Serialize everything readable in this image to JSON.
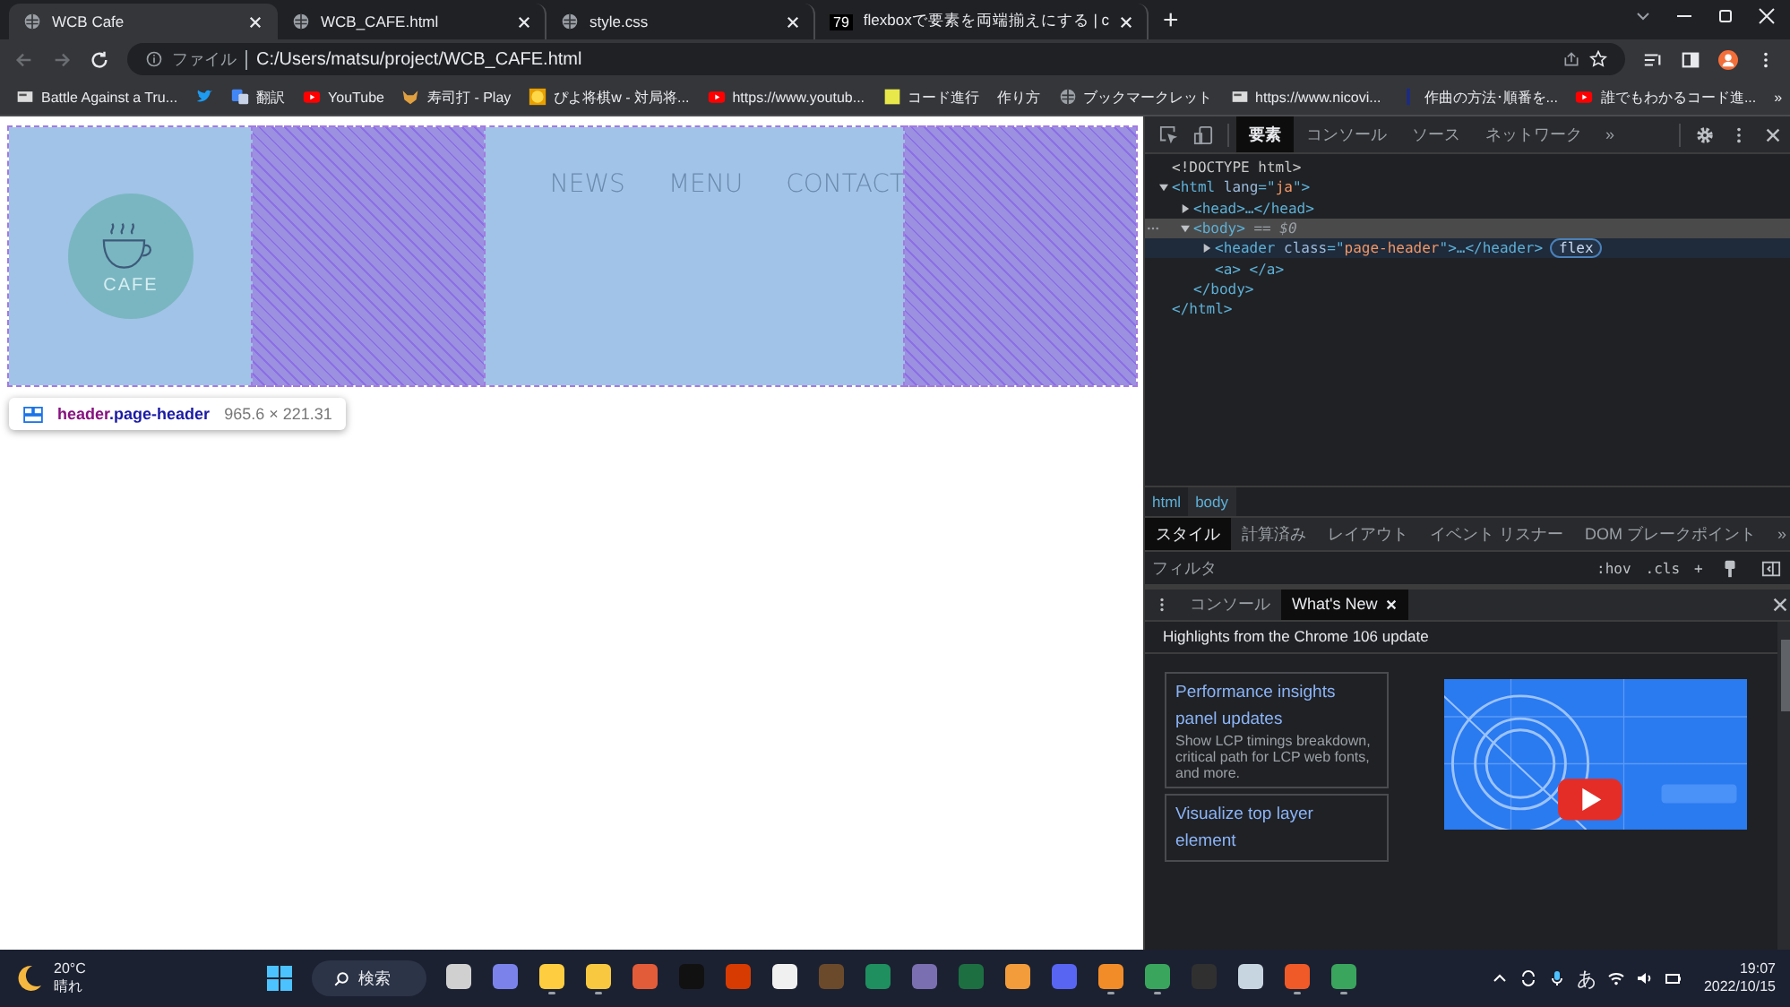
{
  "browser": {
    "tabs": [
      {
        "title": "WCB Cafe",
        "selected": true,
        "kind": "globe"
      },
      {
        "title": "WCB_CAFE.html",
        "selected": false,
        "kind": "globe"
      },
      {
        "title": "style.css",
        "selected": false,
        "kind": "globe"
      },
      {
        "title": "flexboxで要素を両端揃えにする | c",
        "selected": false,
        "kind": "badge",
        "badge": "79"
      }
    ],
    "new_tab": "+",
    "address": {
      "scheme_label": "ファイル",
      "url": "C:/Users/matsu/project/WCB_CAFE.html"
    },
    "bookmarks": [
      {
        "label": "Battle Against a Tru...",
        "kind": "page"
      },
      {
        "kind": "bird"
      },
      {
        "label": "翻訳",
        "kind": "translate"
      },
      {
        "label": "YouTube",
        "kind": "play"
      },
      {
        "label": "寿司打 - Play",
        "kind": "sushi"
      },
      {
        "label": "ぴよ将棋w - 対局将...",
        "kind": "face"
      },
      {
        "label": "https://www.youtub...",
        "kind": "play"
      },
      {
        "label": "コード進行",
        "kind": "folder"
      },
      {
        "label": "作り方",
        "kind": "plain"
      },
      {
        "label": "ブックマークレット",
        "kind": "globe"
      },
      {
        "label": "https://www.nicovi...",
        "kind": "page"
      },
      {
        "label": "作曲の方法･順番を...",
        "kind": "bar"
      },
      {
        "label": "誰でもわかるコード進...",
        "kind": "play"
      }
    ],
    "bookmarks_more": "»"
  },
  "page": {
    "header": {
      "logo_text": "CAFE",
      "nav": [
        "NEWS",
        "MENU",
        "CONTACT"
      ]
    },
    "inspector_tooltip": {
      "tag": "header",
      "class_name": ".page-header",
      "size": "965.6 × 221.31"
    }
  },
  "devtools": {
    "tabs": [
      {
        "label": "要素",
        "selected": true
      },
      {
        "label": "コンソール",
        "selected": false
      },
      {
        "label": "ソース",
        "selected": false
      },
      {
        "label": "ネットワーク",
        "selected": false
      }
    ],
    "tabs_more": "»",
    "dom": [
      {
        "tokens": [
          {
            "text": "<!DOCTYPE html>",
            "kind": "plain"
          }
        ],
        "selected": false,
        "hovered": false
      },
      {
        "tokens": [
          {
            "text": "<html ",
            "kind": "tag"
          },
          {
            "text": "lang",
            "kind": "attr"
          },
          {
            "text": "=\"",
            "kind": "tag"
          },
          {
            "text": "ja",
            "kind": "value"
          },
          {
            "text": "\">",
            "kind": "tag"
          }
        ],
        "selected": false,
        "hovered": false,
        "expanded": true,
        "close": [
          {
            "text": "</html>",
            "kind": "tag"
          }
        ],
        "children": [
          {
            "tokens": [
              {
                "text": "<head>…</head>",
                "kind": "tag"
              }
            ],
            "expanded": false,
            "selected": false,
            "hovered": false
          },
          {
            "tokens": [
              {
                "text": "<body>",
                "kind": "tag"
              },
              {
                "text": " == $0",
                "kind": "note"
              }
            ],
            "expanded": true,
            "selected": true,
            "hovered": false,
            "close": [
              {
                "text": "</body>",
                "kind": "tag"
              }
            ],
            "children": [
              {
                "tokens": [
                  {
                    "text": "<header ",
                    "kind": "tag"
                  },
                  {
                    "text": "class",
                    "kind": "attr"
                  },
                  {
                    "text": "=\"",
                    "kind": "tag"
                  },
                  {
                    "text": "page-header",
                    "kind": "value"
                  },
                  {
                    "text": "\">…</header>",
                    "kind": "tag"
                  }
                ],
                "badge": "flex",
                "expanded": false,
                "selected": false,
                "hovered": true
              },
              {
                "tokens": [
                  {
                    "text": "<a> </a>",
                    "kind": "tag"
                  }
                ],
                "selected": false,
                "hovered": false
              }
            ]
          }
        ]
      }
    ],
    "breadcrumbs": [
      {
        "label": "html",
        "selected": false
      },
      {
        "label": "body",
        "selected": true
      }
    ],
    "styles_tabs": [
      {
        "label": "スタイル",
        "selected": true
      },
      {
        "label": "計算済み",
        "selected": false
      },
      {
        "label": "レイアウト",
        "selected": false
      },
      {
        "label": "イベント リスナー",
        "selected": false
      },
      {
        "label": "DOM ブレークポイント",
        "selected": false
      }
    ],
    "styles_tabs_more": "»",
    "filter": {
      "placeholder": "フィルタ",
      "buttons": [
        ":hov",
        ".cls",
        "+"
      ]
    },
    "drawer": {
      "tabs": [
        {
          "label": "コンソール",
          "selected": false
        },
        {
          "label": "What's New",
          "selected": true
        }
      ],
      "title": "Highlights from the Chrome 106 update",
      "cards": [
        {
          "title": "Performance insights panel updates",
          "text": "Show LCP timings breakdown, critical path for LCP web fonts, and more."
        },
        {
          "title": "Visualize top layer element"
        }
      ]
    }
  },
  "taskbar": {
    "weather": {
      "temp": "20°C",
      "condition": "晴れ"
    },
    "search": "検索",
    "apps": [
      {
        "color": "#d0d0d0",
        "running": false
      },
      {
        "color": "#7b83eb",
        "running": false
      },
      {
        "color": "#ffcd40",
        "running": true
      },
      {
        "color": "#f8c840",
        "running": true
      },
      {
        "color": "#e25c3a",
        "running": false
      },
      {
        "color": "#111111",
        "running": false
      },
      {
        "color": "#d83b01",
        "running": false
      },
      {
        "color": "#f0f0f0",
        "running": false
      },
      {
        "color": "#6b4a2b",
        "running": false
      },
      {
        "color": "#1f8f5f",
        "running": false
      },
      {
        "color": "#7a6fb0",
        "running": false
      },
      {
        "color": "#1d6f42",
        "running": false
      },
      {
        "color": "#f39c3c",
        "running": false
      },
      {
        "color": "#5865f2",
        "running": false
      },
      {
        "color": "#f28c28",
        "running": true
      },
      {
        "color": "#3aa55d",
        "running": true
      },
      {
        "color": "#303030",
        "running": false
      },
      {
        "color": "#c7d5e0",
        "running": false
      },
      {
        "color": "#f05a28",
        "running": true
      },
      {
        "color": "#3aa55d",
        "running": true
      }
    ],
    "ime": "あ",
    "time": "19:07",
    "date": "2022/10/15"
  }
}
